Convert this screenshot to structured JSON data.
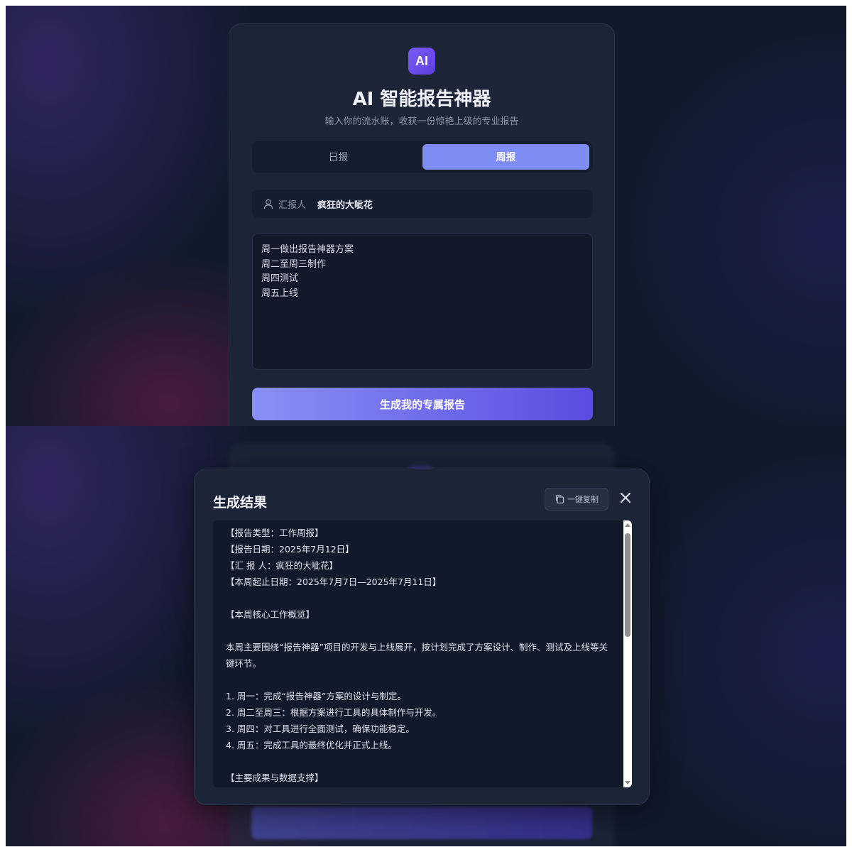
{
  "app": {
    "logo_text": "AI",
    "title": "AI 智能报告神器",
    "subtitle": "输入你的流水账，收获一份惊艳上级的专业报告"
  },
  "tabs": [
    {
      "label": "日报",
      "active": false
    },
    {
      "label": "周报",
      "active": true
    }
  ],
  "reporter": {
    "label": "汇报人",
    "value": "疯狂的大呲花",
    "icon": "user-icon"
  },
  "input": {
    "lines": [
      "周一做出报告神器方案",
      "周二至周三制作",
      "周四测试",
      "周五上线"
    ]
  },
  "generate_button": "生成我的专属报告",
  "modal": {
    "title": "生成结果",
    "copy_label": "一键复制",
    "copy_icon": "copy-icon",
    "close_icon": "close-icon",
    "result_lines": [
      "【报告类型：工作周报】",
      "【报告日期：2025年7月12日】",
      "【汇 报 人：疯狂的大呲花】",
      "【本周起止日期：2025年7月7日—2025年7月11日】",
      "",
      "【本周核心工作概览】",
      "",
      "本周主要围绕“报告神器”项目的开发与上线展开，按计划完成了方案设计、制作、测试及上线等关键环节。",
      "",
      "1. 周一：完成“报告神器”方案的设计与制定。",
      "2. 周二至周三：根据方案进行工具的具体制作与开发。",
      "3. 周四：对工具进行全面测试，确保功能稳定。",
      "4. 周五：完成工具的最终优化并正式上线。",
      "",
      "【主要成果与数据支撑】"
    ]
  },
  "colors": {
    "accent": "#7f8cf3",
    "button_gradient_start": "#8a8ff6",
    "button_gradient_end": "#5a4de0",
    "background": "#101a2d",
    "card": "#1b2537"
  }
}
